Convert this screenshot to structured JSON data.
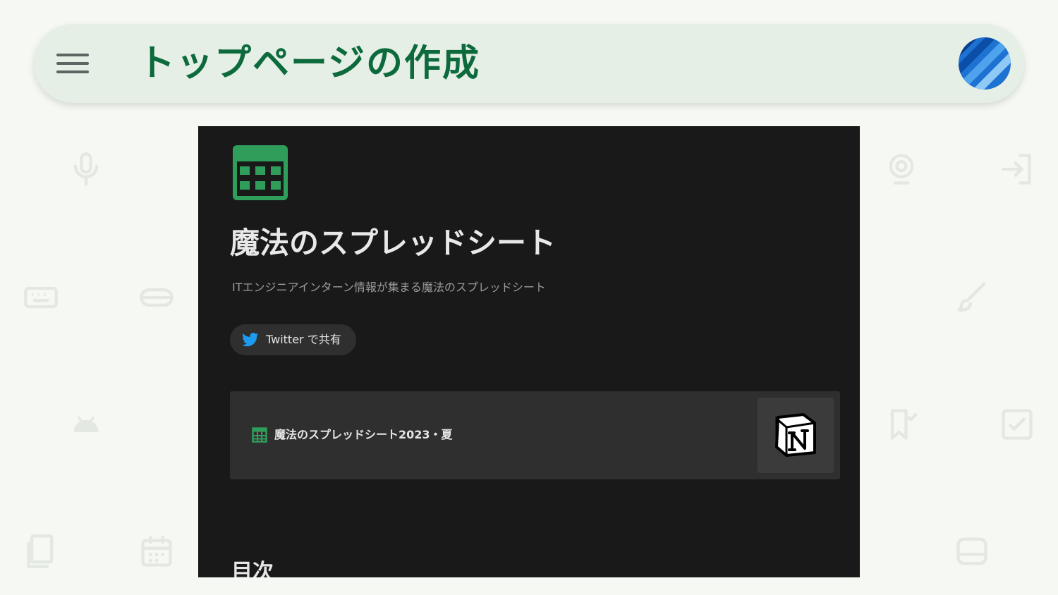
{
  "appbar": {
    "title": "トップページの作成",
    "menu_icon": "hamburger-menu-icon",
    "avatar_icon": "blue-striped-avatar"
  },
  "background_icons": [
    "microphone-icon",
    "webcam-icon",
    "login-icon",
    "keyboard-icon",
    "gamepad-icon",
    "brush-icon",
    "android-icon",
    "bookmark-icon",
    "checkbox-icon",
    "tablet-icon",
    "calendar-icon",
    "device-icon"
  ],
  "screenshot": {
    "page_icon": "calculator-icon",
    "title": "魔法のスプレッドシート",
    "subtitle": "ITエンジニアインターン情報が集まる魔法のスプレッドシート",
    "share_button": {
      "label": "Twitter で共有",
      "icon": "twitter-bird-icon"
    },
    "link_card": {
      "icon": "table-icon",
      "label": "魔法のスプレッドシート2023・夏",
      "thumbnail_icon": "notion-logo-icon"
    },
    "section_heading": "目次"
  },
  "colors": {
    "page_background": "#f6f8f4",
    "appbar_background": "#e5efe6",
    "title_green": "#0d6a3c",
    "dark_background": "#191919",
    "card_background": "#2f2f2f",
    "icon_green": "#2f9e5b",
    "twitter_blue": "#1d9bf0"
  }
}
